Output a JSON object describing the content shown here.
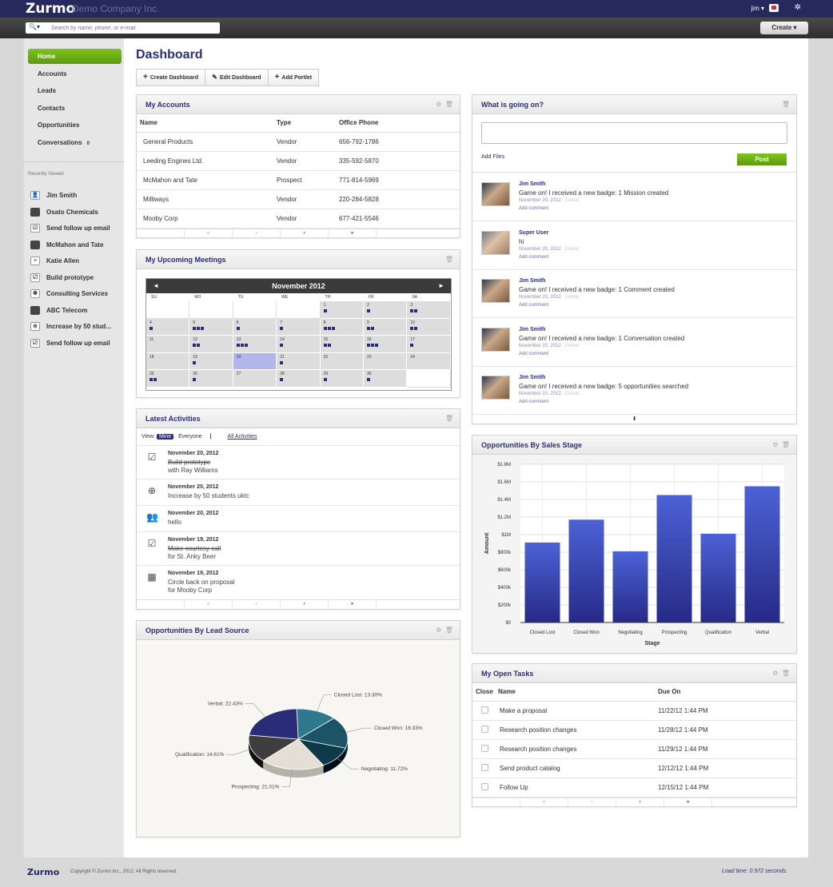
{
  "header": {
    "logo": "Zurmo",
    "company": "Demo Company Inc.",
    "user": "jim ▾",
    "gear": "✲"
  },
  "search": {
    "mag": "🔍▾",
    "placeholder": "Search by name, phone, or e-mail"
  },
  "create_label": "Create ▾",
  "nav": [
    {
      "label": "Home",
      "active": true
    },
    {
      "label": "Accounts"
    },
    {
      "label": "Leads"
    },
    {
      "label": "Contacts"
    },
    {
      "label": "Opportunities"
    },
    {
      "label": "Conversations",
      "badge": "0"
    }
  ],
  "recently_viewed": {
    "title": "Recently Viewed",
    "items": [
      {
        "label": "Jim Smith",
        "icon": "person-icon"
      },
      {
        "label": "Osato Chemicals",
        "icon": "folder-icon"
      },
      {
        "label": "Send follow up email",
        "icon": "task-icon"
      },
      {
        "label": "McMahon and Tate",
        "icon": "folder-icon"
      },
      {
        "label": "Katie Allen",
        "icon": "lead-icon"
      },
      {
        "label": "Build prototype",
        "icon": "task-icon"
      },
      {
        "label": "Consulting Services",
        "icon": "bulb-icon"
      },
      {
        "label": "ABC Telecom",
        "icon": "folder-icon"
      },
      {
        "label": "Increase by 50 stud...",
        "icon": "crosshair-icon"
      },
      {
        "label": "Send follow up email",
        "icon": "task-icon"
      }
    ]
  },
  "page_title": "Dashboard",
  "toolbar": {
    "create": "Create Dashboard",
    "edit": "Edit Dashboard",
    "add": "Add Portlet"
  },
  "accounts": {
    "title": "My Accounts",
    "headers": [
      "Name",
      "Type",
      "Office Phone"
    ],
    "rows": [
      [
        "General Products",
        "Vendor",
        "656-792-1786"
      ],
      [
        "Leeding Engines Ltd.",
        "Vendor",
        "335-592-5870"
      ],
      [
        "McMahon and Tate",
        "Prospect",
        "771-814-5969"
      ],
      [
        "Milliways",
        "Vendor",
        "220-284-5828"
      ],
      [
        "Mooby Corp",
        "Vendor",
        "677-421-5546"
      ]
    ]
  },
  "pager": [
    "«",
    "‹",
    "›",
    "»"
  ],
  "meetings": {
    "title": "My Upcoming Meetings",
    "month": "November 2012",
    "prev": "◄",
    "next": "►",
    "dow": [
      "SU",
      "MO",
      "TU",
      "WE",
      "TH",
      "FR",
      "SA"
    ],
    "today": "20",
    "days": [
      {
        "d": "1",
        "ev": 1
      },
      {
        "d": "2",
        "ev": 1
      },
      {
        "d": "3",
        "ev": 2
      },
      {
        "d": "4",
        "ev": 1
      },
      {
        "d": "5",
        "ev": 3
      },
      {
        "d": "6",
        "ev": 1
      },
      {
        "d": "7",
        "ev": 1
      },
      {
        "d": "8",
        "ev": 3
      },
      {
        "d": "9",
        "ev": 2
      },
      {
        "d": "10",
        "ev": 2
      },
      {
        "d": "11",
        "ev": 0
      },
      {
        "d": "12",
        "ev": 2
      },
      {
        "d": "13",
        "ev": 3
      },
      {
        "d": "14",
        "ev": 1
      },
      {
        "d": "15",
        "ev": 2
      },
      {
        "d": "16",
        "ev": 3
      },
      {
        "d": "17",
        "ev": 1
      },
      {
        "d": "18",
        "ev": 0
      },
      {
        "d": "19",
        "ev": 1
      },
      {
        "d": "20",
        "ev": 0
      },
      {
        "d": "21",
        "ev": 1
      },
      {
        "d": "22",
        "ev": 0
      },
      {
        "d": "23",
        "ev": 0
      },
      {
        "d": "24",
        "ev": 0
      },
      {
        "d": "25",
        "ev": 2
      },
      {
        "d": "26",
        "ev": 1
      },
      {
        "d": "27",
        "ev": 0
      },
      {
        "d": "28",
        "ev": 1
      },
      {
        "d": "29",
        "ev": 1
      },
      {
        "d": "30",
        "ev": 1
      }
    ]
  },
  "activities": {
    "title": "Latest Activities",
    "view_label": "View:",
    "mine": "Mine",
    "everyone": "Everyone",
    "all": "All Activities",
    "items": [
      {
        "date": "November 20, 2012",
        "l1": "Build prototype",
        "l2": "with Ray Williams",
        "strike": true,
        "icon": "checkbox-icon"
      },
      {
        "date": "November 20, 2012",
        "l1": "Increase by 50 students uktc",
        "l2": "",
        "strike": false,
        "icon": "crosshair-icon"
      },
      {
        "date": "November 20, 2012",
        "l1": "hello",
        "l2": "",
        "strike": false,
        "icon": "conversation-icon"
      },
      {
        "date": "November 19, 2012",
        "l1": "Make courtesy call",
        "l2": "for St. Anky Beer",
        "strike": true,
        "icon": "checkbox-icon"
      },
      {
        "date": "November 19, 2012",
        "l1": "Circle back on proposal",
        "l2": "for Mooby Corp",
        "strike": false,
        "icon": "calendar-icon"
      }
    ]
  },
  "lead_source": {
    "title": "Opportunities By Lead Source"
  },
  "feed": {
    "title": "What is going on?",
    "add_files": "Add Files",
    "post": "Post",
    "more": "⬇",
    "items": [
      {
        "name": "Jim Smith",
        "text": "Game on! I received a new badge: 1 Mission created",
        "date": "November 20, 2012",
        "del": "Delete",
        "add": "Add comment"
      },
      {
        "name": "Super User",
        "text": "hi",
        "date": "November 20, 2012",
        "del": "Delete",
        "add": "Add comment"
      },
      {
        "name": "Jim Smith",
        "text": "Game on! I received a new badge: 1 Comment created",
        "date": "November 20, 2012",
        "del": "Delete",
        "add": "Add comment"
      },
      {
        "name": "Jim Smith",
        "text": "Game on! I received a new badge: 1 Conversation created",
        "date": "November 20, 2012",
        "del": "Delete",
        "add": "Add comment"
      },
      {
        "name": "Jim Smith",
        "text": "Game on! I received a new badge: 5 opportunities searched",
        "date": "November 20, 2012",
        "del": "Delete",
        "add": "Add comment"
      }
    ]
  },
  "sales_stage": {
    "title": "Opportunities By Sales Stage"
  },
  "tasks": {
    "title": "My Open Tasks",
    "headers": [
      "Close",
      "Name",
      "Due On"
    ],
    "rows": [
      [
        "Make a proposal",
        "11/22/12 1:44 PM"
      ],
      [
        "Research position changes",
        "11/28/12 1:44 PM"
      ],
      [
        "Research position changes",
        "11/29/12 1:44 PM"
      ],
      [
        "Send product catalog",
        "12/12/12 1:44 PM"
      ],
      [
        "Follow Up",
        "12/15/12 1:44 PM"
      ]
    ]
  },
  "footer": {
    "logo": "Zurmo",
    "copy": "Copyright © Zurmo Inc., 2012. All Rights reserved.",
    "load": "Load time: 0.972 seconds."
  },
  "chart_data": [
    {
      "type": "bar",
      "categories": [
        "Closed Lost",
        "Closed Won",
        "Negotiating",
        "Prospecting",
        "Qualification",
        "Verbal"
      ],
      "values": [
        910000,
        1170000,
        810000,
        1450000,
        1010000,
        1550000
      ],
      "ytick_labels": [
        "$0",
        "$200k",
        "$400k",
        "$600k",
        "$800k",
        "$1M",
        "$1.2M",
        "$1.4M",
        "$1.6M",
        "$1.8M"
      ],
      "xlabel": "Stage",
      "ylabel": "Amount",
      "ylim": [
        0,
        1800000
      ],
      "color": "#3b4fc8"
    },
    {
      "type": "pie",
      "labels": [
        "Closed Lost",
        "Closed Won",
        "Negotiating",
        "Prospecting",
        "Qualification",
        "Verbal"
      ],
      "values": [
        13.3,
        16.93,
        11.72,
        21.01,
        14.61,
        22.43
      ],
      "label_texts": [
        "Closed Lost: 13.30%",
        "Closed Won: 16.93%",
        "Negotiating: 11.72%",
        "Prospecting: 21.01%",
        "Qualification: 14.61%",
        "Verbal: 22.43%"
      ],
      "colors": [
        "#2e7a8c",
        "#1d5366",
        "#0e3a48",
        "#e4dfd5",
        "#3e3e3e",
        "#2a2c78"
      ]
    }
  ]
}
